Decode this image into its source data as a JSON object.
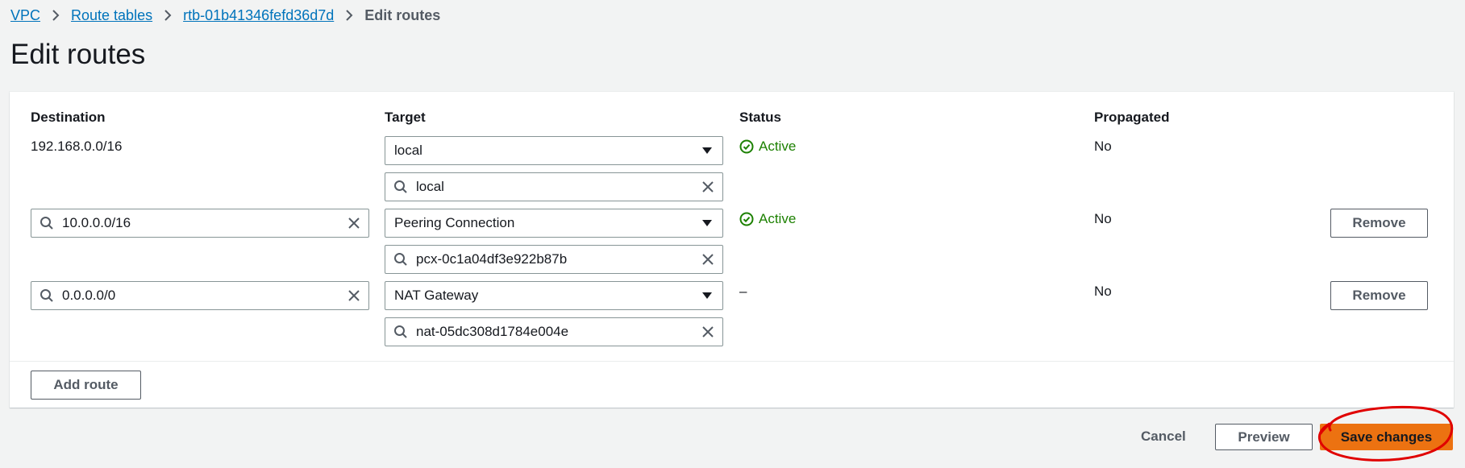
{
  "breadcrumb": {
    "items": [
      "VPC",
      "Route tables",
      "rtb-01b41346fefd36d7d"
    ],
    "current": "Edit routes"
  },
  "page": {
    "title": "Edit routes"
  },
  "table": {
    "columns": [
      "Destination",
      "Target",
      "Status",
      "Propagated"
    ],
    "rows": [
      {
        "destination": "192.168.0.0/16",
        "target_type": "local",
        "target_search": "local",
        "status": "Active",
        "propagated": "No"
      },
      {
        "destination": "10.0.0.0/16",
        "target_type": "Peering Connection",
        "target_search": "pcx-0c1a04df3e922b87b",
        "status": "Active",
        "propagated": "No",
        "remove_label": "Remove"
      },
      {
        "destination": "0.0.0.0/0",
        "target_type": "NAT Gateway",
        "target_search": "nat-05dc308d1784e004e",
        "status": "–",
        "propagated": "No",
        "remove_label": "Remove"
      }
    ]
  },
  "actions": {
    "add_route": "Add route",
    "cancel": "Cancel",
    "preview": "Preview",
    "save": "Save changes"
  },
  "colors": {
    "link": "#0073bb",
    "success": "#1d8102",
    "primary": "#ec7211",
    "annotation": "#e00000"
  },
  "icons": [
    "chevron-right-icon",
    "search-icon",
    "clear-icon",
    "caret-down-icon",
    "status-success-icon"
  ]
}
